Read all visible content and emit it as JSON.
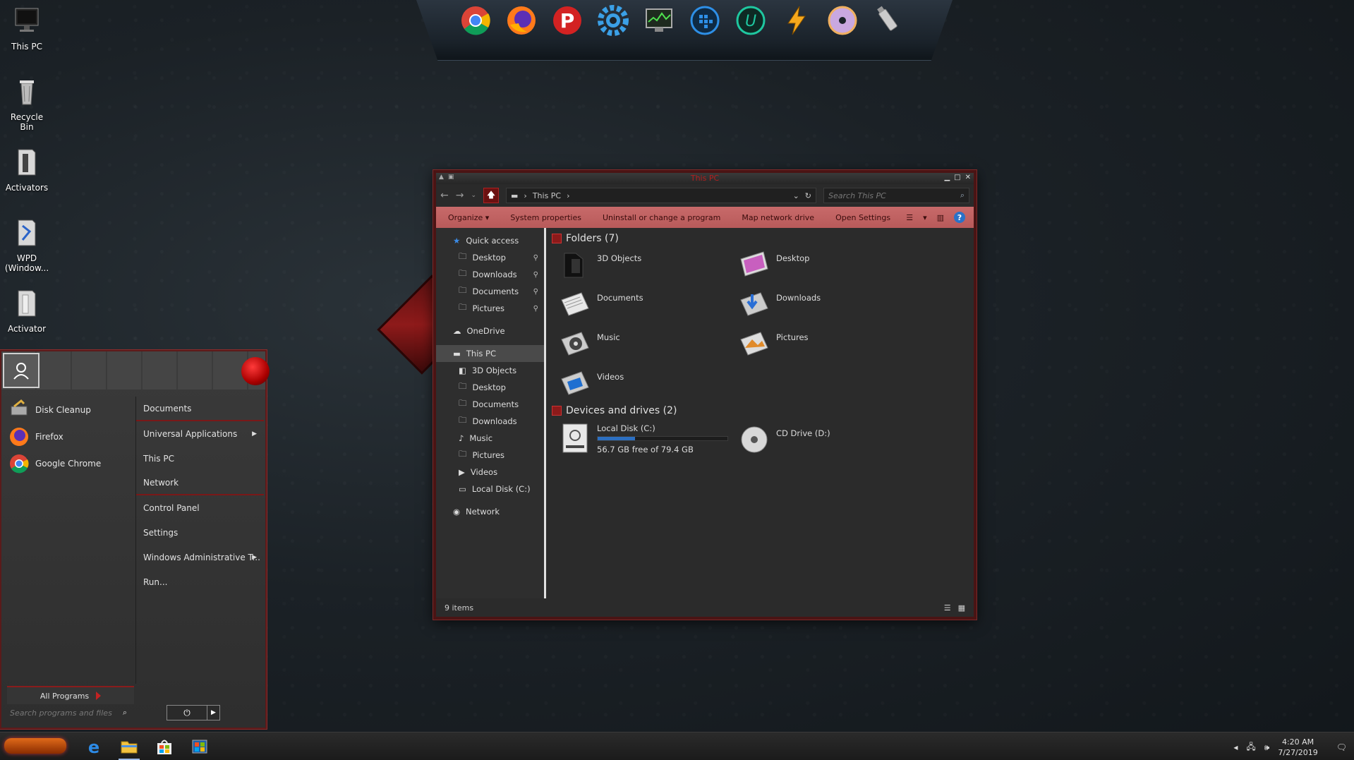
{
  "desktop": {
    "icons": [
      {
        "label": "This PC"
      },
      {
        "label": "Recycle Bin"
      },
      {
        "label": "Activators"
      },
      {
        "label": "WPD (Window..."
      },
      {
        "label": "Activator"
      }
    ]
  },
  "dock": {
    "icons": [
      "chrome-icon",
      "firefox-icon",
      "p-app-icon",
      "settings-gear-icon",
      "system-monitor-icon",
      "grid-app-icon",
      "u-app-icon",
      "lightning-app-icon",
      "dvd-icon",
      "usb-drive-icon"
    ]
  },
  "explorer": {
    "title": "This PC",
    "address": {
      "location": "This PC"
    },
    "search": {
      "placeholder": "Search This PC"
    },
    "commands": {
      "organize": "Organize",
      "system_properties": "System properties",
      "uninstall": "Uninstall or change a program",
      "map_drive": "Map network drive",
      "open_settings": "Open Settings"
    },
    "nav": {
      "quick_access": "Quick access",
      "quick_items": [
        "Desktop",
        "Downloads",
        "Documents",
        "Pictures"
      ],
      "onedrive": "OneDrive",
      "this_pc": "This PC",
      "pc_items": [
        "3D Objects",
        "Desktop",
        "Documents",
        "Downloads",
        "Music",
        "Pictures",
        "Videos",
        "Local Disk (C:)"
      ],
      "network": "Network"
    },
    "folders_header": "Folders (7)",
    "folders": [
      "3D Objects",
      "Desktop",
      "Documents",
      "Downloads",
      "Music",
      "Pictures",
      "Videos"
    ],
    "devices_header": "Devices and drives (2)",
    "drives": {
      "c_name": "Local Disk (C:)",
      "c_free": "56.7 GB free of 79.4 GB",
      "c_used_fraction": 0.286,
      "d_name": "CD Drive (D:)"
    },
    "status": {
      "items": "9 items"
    }
  },
  "start_menu": {
    "programs": [
      "Disk Cleanup",
      "Firefox",
      "Google Chrome"
    ],
    "all_programs": "All Programs",
    "search_placeholder": "Search programs and files",
    "right_items": [
      "Documents",
      "Universal Applications",
      "This PC",
      "Network",
      "Control Panel",
      "Settings",
      "Windows Administrative T...",
      "Run..."
    ]
  },
  "taskbar": {
    "time": "4:20 AM",
    "date": "7/27/2019"
  },
  "colors": {
    "accent_red": "#b51f1f",
    "command_bar": "#c86a6a",
    "drive_bar": "#2c6fc1"
  }
}
